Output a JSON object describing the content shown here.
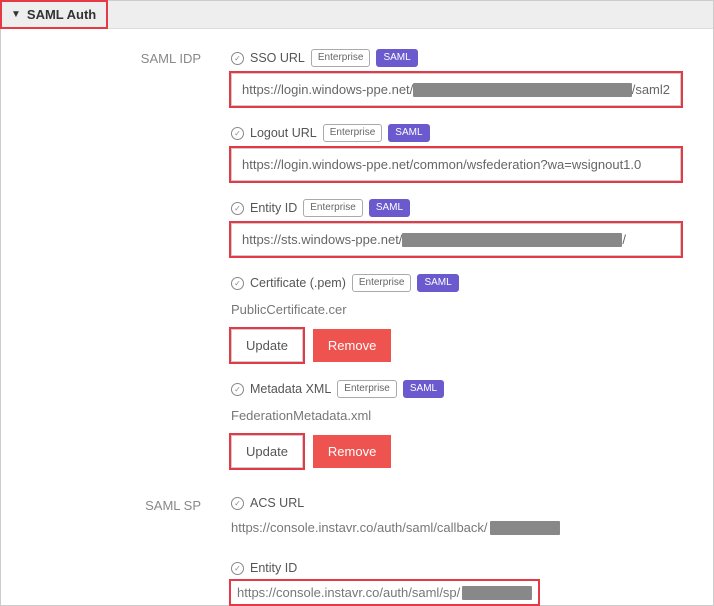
{
  "header": {
    "title": "SAML Auth"
  },
  "badges": {
    "enterprise": "Enterprise",
    "saml": "SAML"
  },
  "idp": {
    "section_label": "SAML IDP",
    "sso_url": {
      "label": "SSO URL",
      "value_prefix": "https://login.windows-ppe.net/",
      "value_suffix": "/saml2"
    },
    "logout_url": {
      "label": "Logout URL",
      "value": "https://login.windows-ppe.net/common/wsfederation?wa=wsignout1.0"
    },
    "entity_id": {
      "label": "Entity ID",
      "value_prefix": "https://sts.windows-ppe.net/",
      "value_suffix": "/"
    },
    "certificate": {
      "label": "Certificate (.pem)",
      "filename": "PublicCertificate.cer",
      "update_btn": "Update",
      "remove_btn": "Remove"
    },
    "metadata": {
      "label": "Metadata XML",
      "filename": "FederationMetadata.xml",
      "update_btn": "Update",
      "remove_btn": "Remove"
    }
  },
  "sp": {
    "section_label": "SAML SP",
    "acs_url": {
      "label": "ACS URL",
      "value_prefix": "https://console.instavr.co/auth/saml/callback/"
    },
    "entity_id": {
      "label": "Entity ID",
      "value_prefix": "https://console.instavr.co/auth/saml/sp/"
    }
  }
}
